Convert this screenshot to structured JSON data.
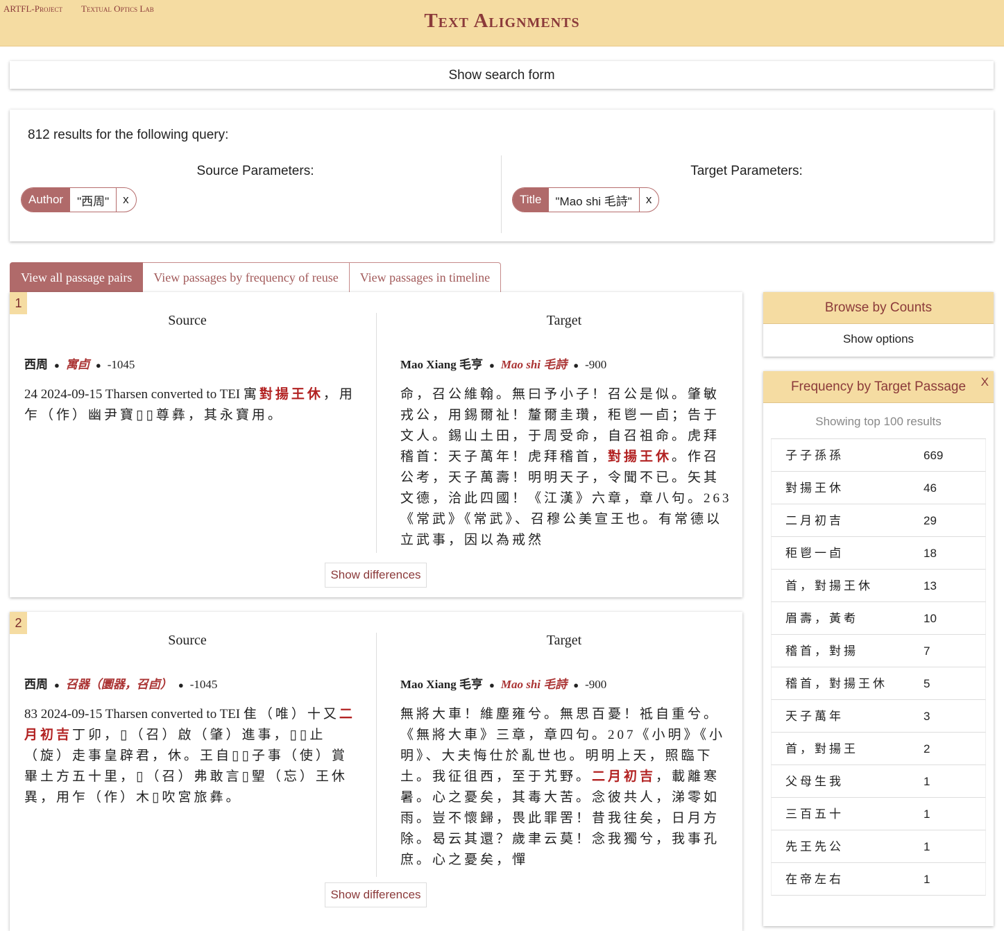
{
  "header": {
    "links": [
      "ARTFL-Project",
      "Textual Optics Lab"
    ],
    "title": "Text Alignments"
  },
  "search_toggle": "Show search form",
  "query": {
    "summary": "812 results for the following query:",
    "source_title": "Source Parameters:",
    "target_title": "Target Parameters:",
    "source_chip": {
      "label": "Author",
      "value": "\"西周\"",
      "remove": "x"
    },
    "target_chip": {
      "label": "Title",
      "value": "\"Mao shi 毛詩\"",
      "remove": "x"
    }
  },
  "tabs": [
    "View all passage pairs",
    "View passages by frequency of reuse",
    "View passages in timeline"
  ],
  "pairs": [
    {
      "num": "1",
      "source_head": "Source",
      "target_head": "Target",
      "source_meta": {
        "author": "西周",
        "title": "寓卣",
        "year": "-1045"
      },
      "target_meta": {
        "author": "Mao Xiang 毛亨",
        "title": "Mao shi 毛詩",
        "year": "-900"
      },
      "source_text": {
        "lead": "24 2024-09-15 Tharsen converted to TEI ",
        "before": "寓",
        "hl": "對揚王休",
        "after": "，用乍（作）幽尹寶▯▯尊彝，其永寶用。"
      },
      "target_text": {
        "before": "命，召公維翰。無曰予小子！召公是似。肇敏戎公，用錫爾祉！釐爾圭瓚，秬鬯一卣；告于文人。錫山土田，于周受命，自召祖命。虎拜稽首：天子萬年！虎拜稽首，",
        "hl": "對揚王休",
        "after": "。作召公考，天子萬壽！明明天子，令聞不已。矢其文德，洽此四國！《江漢》六章，章八句。263《常武》《常武》、召穆公美宣王也。有常德以立武事，因以為戒然"
      },
      "diff_button": "Show differences"
    },
    {
      "num": "2",
      "source_head": "Source",
      "target_head": "Target",
      "source_meta": {
        "author": "西周",
        "title": "召器（圜器，召卣）",
        "year": "-1045"
      },
      "target_meta": {
        "author": "Mao Xiang 毛亨",
        "title": "Mao shi 毛詩",
        "year": "-900"
      },
      "source_text": {
        "lead": "83 2024-09-15 Tharsen converted to TEI ",
        "before": "隹（唯）十又",
        "hl": "二月初吉",
        "after": "丁卯，▯（召）啟（肇）進事，▯▯止（旋）走事皇辟君，休。王自▯▯子事（使）賞畢土方五十里，▯（召）弗敢言▯朢（忘）王休異，用乍（作）木▯吹宮旅彝。"
      },
      "target_text": {
        "before": "無將大車！維塵雍兮。無思百憂！祗自重兮。《無將大車》三章，章四句。207《小明》《小明》、大夫悔仕於亂世也。明明上天，照臨下土。我征徂西，至于艽野。",
        "hl": "二月初吉",
        "after": "，載離寒暑。心之憂矣，其毒大苦。念彼共人，涕零如雨。豈不懷歸，畏此罪罟！昔我往矣，日月方除。曷云其還？歲聿云莫！念我獨兮，我事孔庶。心之憂矣，憚"
      },
      "diff_button": "Show differences"
    }
  ],
  "browse": {
    "title": "Browse by Counts",
    "options": "Show options"
  },
  "frequency": {
    "title": "Frequency by Target  Passage",
    "close": "X",
    "showing": "Showing top 100 results",
    "rows": [
      {
        "passage": "子子孫孫",
        "count": "669"
      },
      {
        "passage": "對揚王休",
        "count": "46"
      },
      {
        "passage": "二月初吉",
        "count": "29"
      },
      {
        "passage": "秬鬯一卣",
        "count": "18"
      },
      {
        "passage": "首，對揚王休",
        "count": "13"
      },
      {
        "passage": "眉壽，黃耇",
        "count": "10"
      },
      {
        "passage": "稽首，對揚",
        "count": "7"
      },
      {
        "passage": "稽首，對揚王休",
        "count": "5"
      },
      {
        "passage": "天子萬年",
        "count": "3"
      },
      {
        "passage": "首，對揚王",
        "count": "2"
      },
      {
        "passage": "父母生我",
        "count": "1"
      },
      {
        "passage": "三百五十",
        "count": "1"
      },
      {
        "passage": "先王先公",
        "count": "1"
      },
      {
        "passage": "在帝左右",
        "count": "1"
      }
    ]
  }
}
